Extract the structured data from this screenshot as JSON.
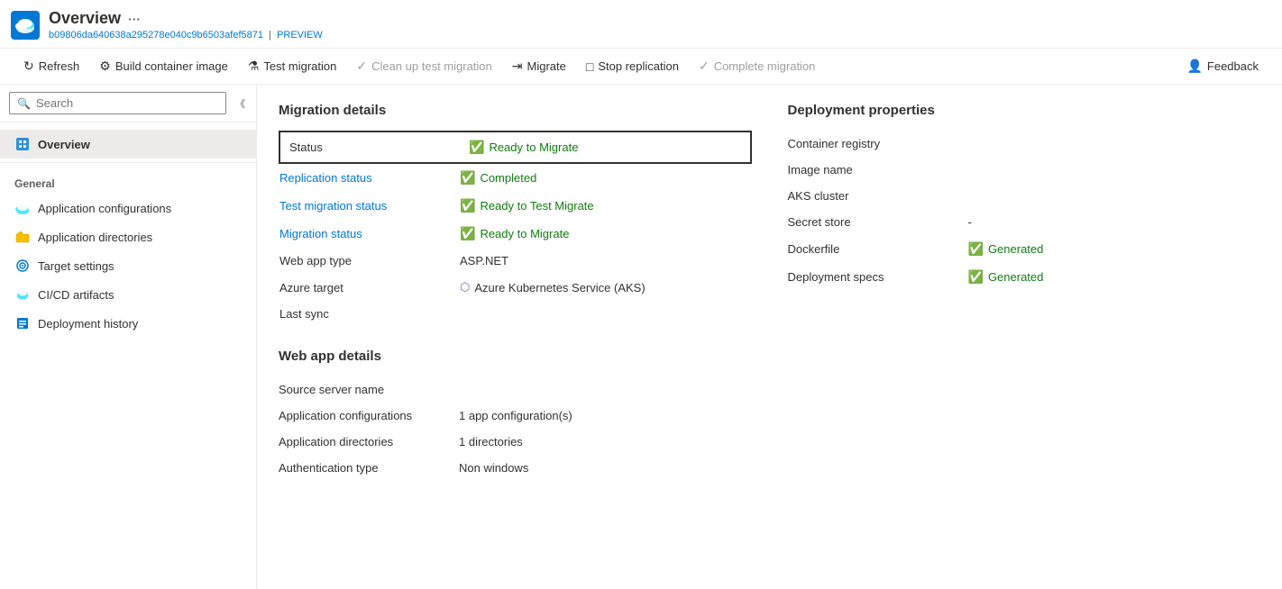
{
  "header": {
    "title": "Overview",
    "more_icon": "···",
    "subtitle": "b09806da640638a295278e040c9b6503afef5871",
    "subtitle_link": "PREVIEW"
  },
  "toolbar": {
    "refresh": "Refresh",
    "build_container": "Build container image",
    "test_migration": "Test migration",
    "clean_up": "Clean up test migration",
    "migrate": "Migrate",
    "stop_replication": "Stop replication",
    "complete_migration": "Complete migration",
    "feedback": "Feedback"
  },
  "sidebar": {
    "search_placeholder": "Search",
    "overview_label": "Overview",
    "general_label": "General",
    "nav_items": [
      {
        "label": "Application configurations",
        "icon": "cloud"
      },
      {
        "label": "Application directories",
        "icon": "folder"
      },
      {
        "label": "Target settings",
        "icon": "settings"
      },
      {
        "label": "CI/CD artifacts",
        "icon": "cloud2"
      },
      {
        "label": "Deployment history",
        "icon": "cube"
      }
    ]
  },
  "migration_details": {
    "section_title": "Migration details",
    "rows": [
      {
        "label": "Status",
        "value": "Ready to Migrate",
        "type": "status_badge",
        "is_status_row": true
      },
      {
        "label": "Replication status",
        "value": "Completed",
        "type": "badge_green",
        "label_link": true
      },
      {
        "label": "Test migration status",
        "value": "Ready to Test Migrate",
        "type": "badge_green",
        "label_link": true
      },
      {
        "label": "Migration status",
        "value": "Ready to Migrate",
        "type": "badge_green",
        "label_link": true
      },
      {
        "label": "Web app type",
        "value": "ASP.NET",
        "type": "text"
      },
      {
        "label": "Azure target",
        "value": "Azure Kubernetes Service (AKS)",
        "type": "aks"
      },
      {
        "label": "Last sync",
        "value": "",
        "type": "text"
      }
    ]
  },
  "web_app_details": {
    "section_title": "Web app details",
    "rows": [
      {
        "label": "Source server name",
        "value": ""
      },
      {
        "label": "Application configurations",
        "value": "1 app configuration(s)"
      },
      {
        "label": "Application directories",
        "value": "1 directories"
      },
      {
        "label": "Authentication type",
        "value": "Non windows"
      }
    ]
  },
  "deployment_properties": {
    "section_title": "Deployment properties",
    "rows": [
      {
        "label": "Container registry",
        "value": ""
      },
      {
        "label": "Image name",
        "value": ""
      },
      {
        "label": "AKS cluster",
        "value": ""
      },
      {
        "label": "Secret store",
        "value": "-"
      },
      {
        "label": "Dockerfile",
        "value": "Generated",
        "type": "badge_green"
      },
      {
        "label": "Deployment specs",
        "value": "Generated",
        "type": "badge_green"
      }
    ]
  }
}
